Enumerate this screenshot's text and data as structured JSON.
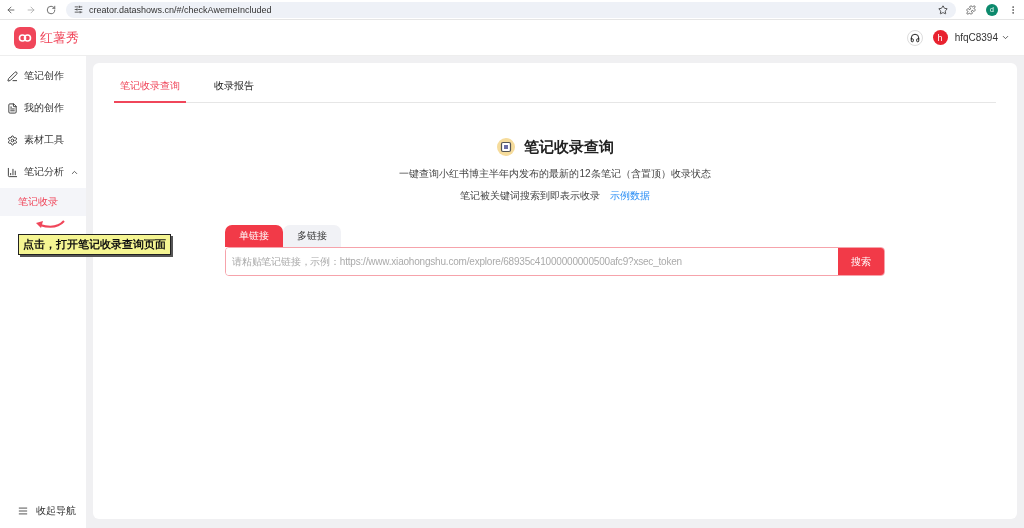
{
  "browser": {
    "url": "creator.datashows.cn/#/checkAwemeIncluded",
    "profile": "d"
  },
  "header": {
    "logo_text": "红薯秀",
    "avatar": "h",
    "username": "hfqC8394"
  },
  "sidebar": {
    "items": [
      {
        "label": "笔记创作"
      },
      {
        "label": "我的创作"
      },
      {
        "label": "素材工具"
      },
      {
        "label": "笔记分析",
        "expanded": true,
        "children": [
          {
            "label": "笔记收录",
            "selected": true
          }
        ]
      }
    ],
    "collapse": "收起导航"
  },
  "annotation": "点击，打开笔记收录查询页面",
  "tabs": [
    {
      "label": "笔记收录查询",
      "selected": true
    },
    {
      "label": "收录报告",
      "selected": false
    }
  ],
  "hero": {
    "title": "笔记收录查询",
    "description": "一键查询小红书博主半年内发布的最新的12条笔记（含置顶）收录状态",
    "note": "笔记被关键词搜索到即表示收录",
    "link": "示例数据"
  },
  "search": {
    "modes": [
      {
        "label": "单链接",
        "selected": true
      },
      {
        "label": "多链接",
        "selected": false
      }
    ],
    "placeholder": "请粘贴笔记链接，示例：https://www.xiaohongshu.com/explore/68935c41000000000500afc9?xsec_token",
    "button": "搜索"
  }
}
